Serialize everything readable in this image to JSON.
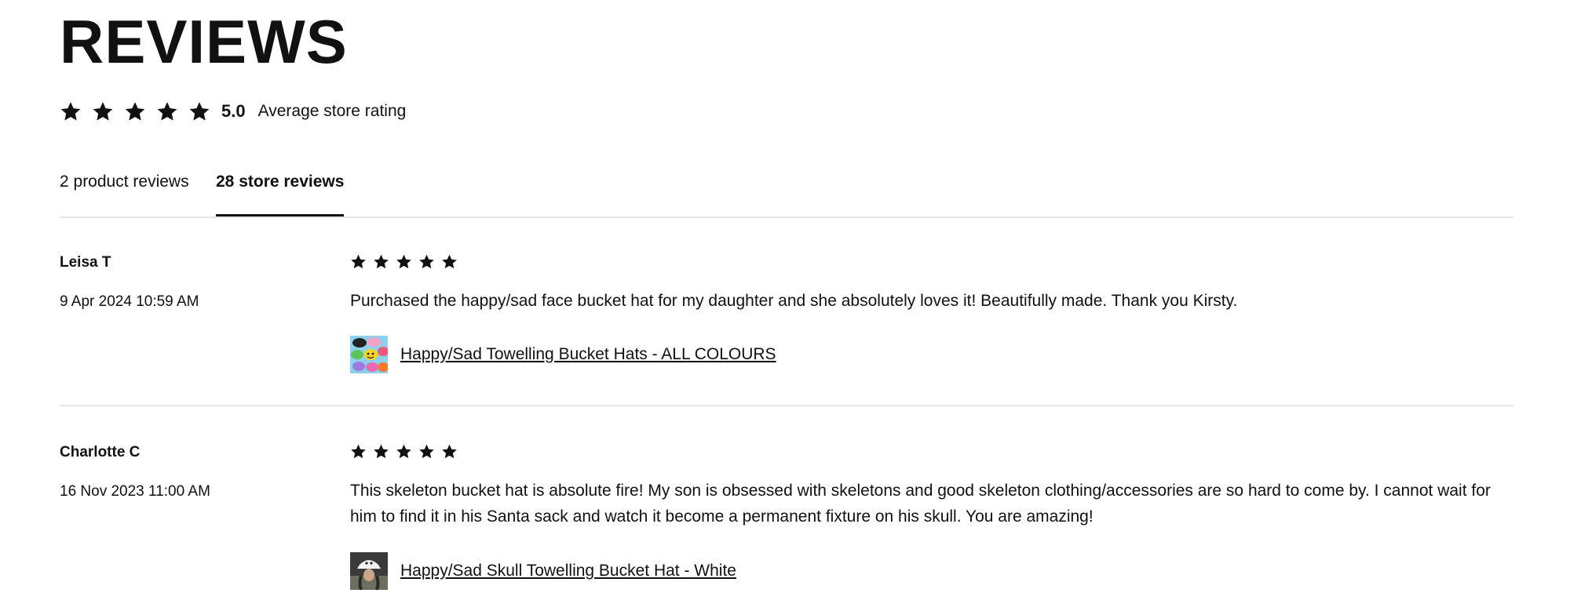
{
  "page": {
    "title": "REVIEWS",
    "average_rating": "5.0",
    "average_rating_label": "Average store rating",
    "average_stars": 5
  },
  "tabs": [
    {
      "label": "2 product reviews",
      "active": false
    },
    {
      "label": "28 store reviews",
      "active": true
    }
  ],
  "reviews": [
    {
      "author": "Leisa T",
      "date": "9 Apr 2024 10:59 AM",
      "stars": 5,
      "text": "Purchased the happy/sad face bucket hat for my daughter and she absolutely loves it! Beautifully made. Thank you Kirsty.",
      "product": {
        "name": "Happy/Sad Towelling Bucket Hats - ALL COLOURS",
        "thumbnail_icon": "multicolor-bucket-hats-thumbnail"
      }
    },
    {
      "author": "Charlotte C",
      "date": "16 Nov 2023 11:00 AM",
      "stars": 5,
      "text": "This skeleton bucket hat is absolute fire! My son is obsessed with skeletons and good skeleton clothing/accessories are so hard to come by. I cannot wait for him to find it in his Santa sack and watch it become a permanent fixture on his skull. You are amazing!",
      "product": {
        "name": "Happy/Sad Skull Towelling Bucket Hat - White",
        "thumbnail_icon": "skull-bucket-hat-thumbnail"
      }
    }
  ],
  "colors": {
    "text": "#111111",
    "divider": "#e5e5e5",
    "background": "#ffffff"
  }
}
